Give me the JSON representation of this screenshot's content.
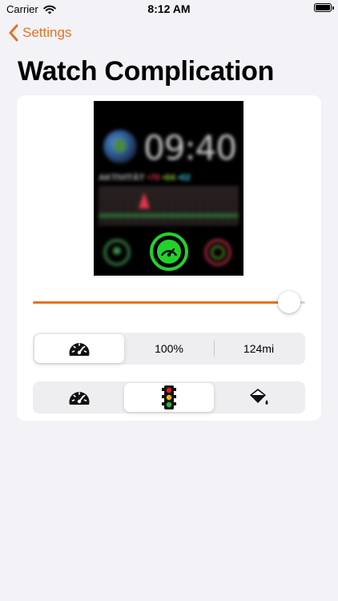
{
  "status_bar": {
    "carrier": "Carrier",
    "time": "8:12 AM"
  },
  "nav": {
    "back_label": "Settings",
    "title": "Watch Complication"
  },
  "watch_preview": {
    "time": "09:40",
    "activity_label": "AKTIVITÄT",
    "move_value": "•70",
    "exercise_value": "•04",
    "stand_value": "•02"
  },
  "slider": {
    "value_fraction": 0.95,
    "accent_color": "#e8711c"
  },
  "segment_display": {
    "items": [
      {
        "icon": "speedometer-icon",
        "label": ""
      },
      {
        "label": "100%"
      },
      {
        "label": "124mi"
      }
    ],
    "selected_index": 0
  },
  "segment_style": {
    "items": [
      {
        "icon": "speedometer-icon"
      },
      {
        "icon": "traffic-light-icon"
      },
      {
        "icon": "paint-bucket-icon"
      }
    ],
    "selected_index": 1
  },
  "colors": {
    "accent": "#e8711c",
    "complication_green": "#22d12a",
    "background": "#f2f2f7"
  }
}
